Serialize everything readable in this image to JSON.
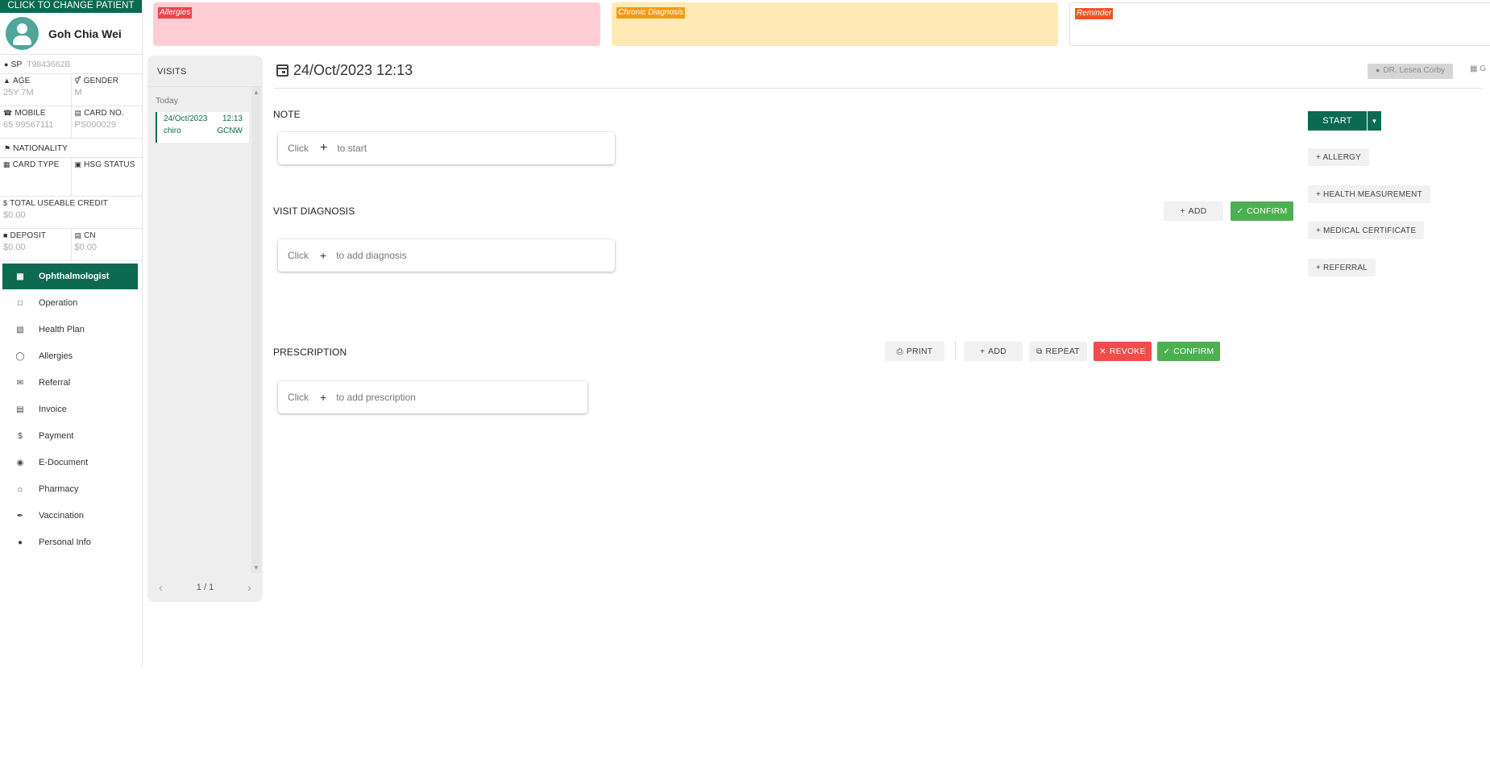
{
  "patient": {
    "change_label": "CLICK TO CHANGE PATIENT",
    "name": "Goh Chia Wei",
    "id_type": "SP",
    "id_value": "T9843662B",
    "age_label": "AGE",
    "age_value": "25Y 7M",
    "gender_label": "GENDER",
    "gender_value": "M",
    "mobile_label": "MOBILE",
    "mobile_value": "65 99567111",
    "card_no_label": "CARD NO.",
    "card_no_value": "PS000029",
    "nationality_label": "NATIONALITY",
    "card_type_label": "CARD TYPE",
    "hsg_status_label": "HSG STATUS",
    "credit_label": "TOTAL USEABLE CREDIT",
    "credit_value": "$0.00",
    "deposit_label": "DEPOSIT",
    "deposit_value": "$0.00",
    "cn_label": "CN",
    "cn_value": "$0.00"
  },
  "menu": {
    "items": [
      {
        "label": "Ophthalmologist",
        "icon": "plus-square-icon",
        "active": true
      },
      {
        "label": "Operation",
        "icon": "plus-square-outline-icon"
      },
      {
        "label": "Health Plan",
        "icon": "clipboard-icon"
      },
      {
        "label": "Allergies",
        "icon": "alert-circle-icon"
      },
      {
        "label": "Referral",
        "icon": "referral-icon"
      },
      {
        "label": "Invoice",
        "icon": "invoice-icon"
      },
      {
        "label": "Payment",
        "icon": "dollar-icon"
      },
      {
        "label": "E-Document",
        "icon": "eye-icon"
      },
      {
        "label": "Pharmacy",
        "icon": "pharmacy-icon"
      },
      {
        "label": "Vaccination",
        "icon": "syringe-icon"
      },
      {
        "label": "Personal Info",
        "icon": "person-icon"
      }
    ]
  },
  "alerts": {
    "allergies": "Allergies",
    "chronic": "Chronic Diagnosis",
    "reminder": "Reminder"
  },
  "visits": {
    "title": "VISITS",
    "today": "Today",
    "list": [
      {
        "date": "24/Oct/2023",
        "time": "12:13",
        "type": "chiro",
        "code": "GCNW"
      }
    ],
    "pager": "1 / 1"
  },
  "visit": {
    "datetime": "24/Oct/2023 12:13",
    "doctor": "DR. Lesea Corby",
    "clinic": "G"
  },
  "note": {
    "title": "NOTE",
    "click": "Click",
    "hint": "to start"
  },
  "diagnosis": {
    "title": "VISIT DIAGNOSIS",
    "add": "ADD",
    "confirm": "CONFIRM",
    "click": "Click",
    "hint": "to add diagnosis"
  },
  "prescription": {
    "title": "PRESCRIPTION",
    "print": "PRINT",
    "add": "ADD",
    "repeat": "REPEAT",
    "revoke": "REVOKE",
    "confirm": "CONFIRM",
    "click": "Click",
    "hint": "to add prescription"
  },
  "actions": {
    "start": "START",
    "allergy": "+ ALLERGY",
    "health_measurement": "+ HEALTH MEASUREMENT",
    "medical_certificate": "+ MEDICAL CERTIFICATE",
    "referral": "+ REFERRAL"
  },
  "colors": {
    "brand": "#0b6a4f",
    "allergies_bg": "#ffcdd3",
    "chronic_bg": "#ffeab6",
    "confirm": "#4caf50",
    "revoke": "#f14c4c"
  }
}
